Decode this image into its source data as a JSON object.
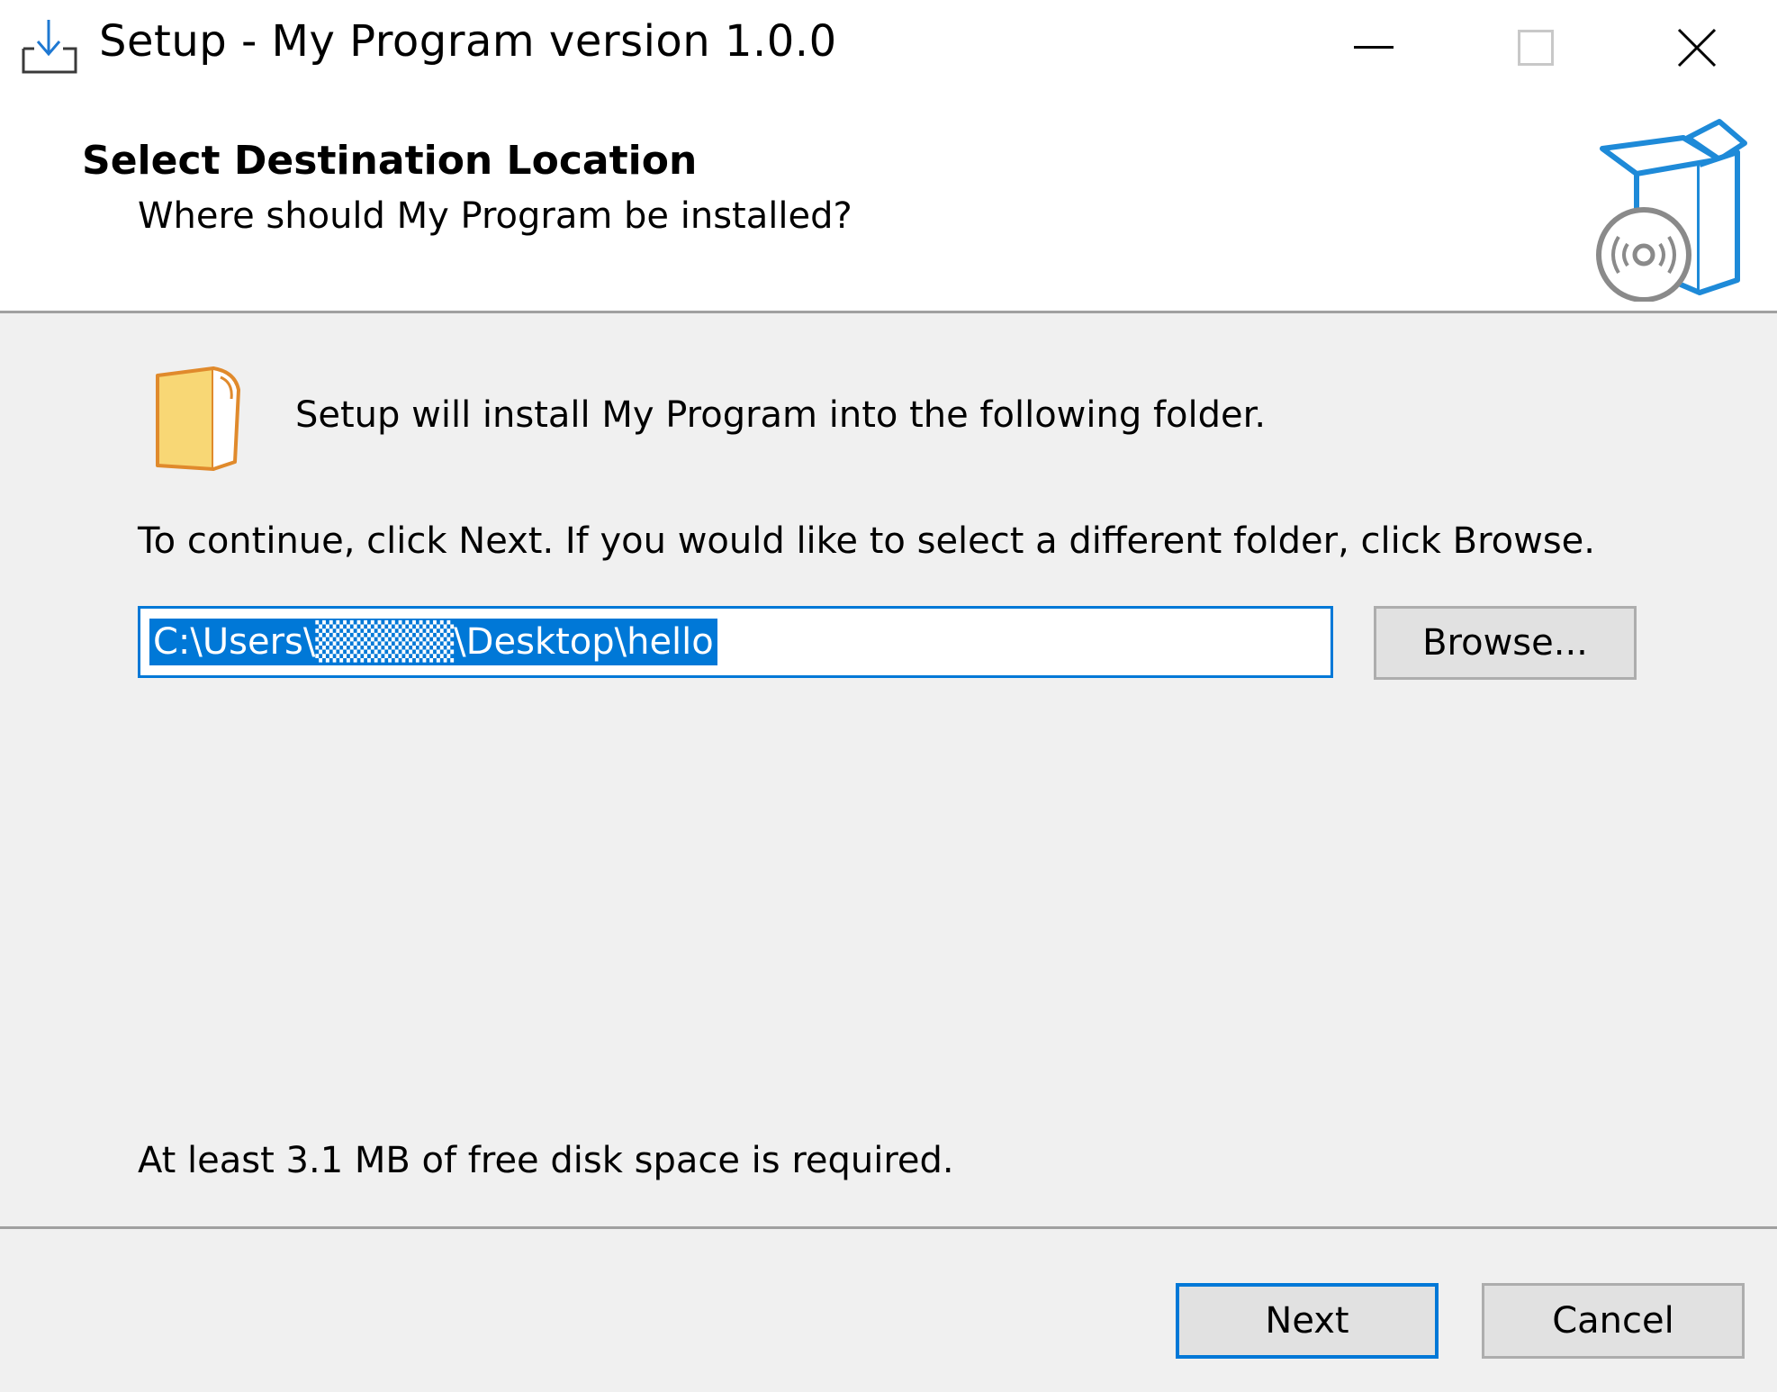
{
  "window": {
    "title": "Setup - My Program version 1.0.0",
    "controls": {
      "minimize_icon": "minimize-icon",
      "maximize_icon": "maximize-icon",
      "close_icon": "close-icon"
    }
  },
  "header": {
    "title": "Select Destination Location",
    "subtitle": "Where should My Program be installed?",
    "graphic_icon": "setup-box-icon"
  },
  "body": {
    "folder_icon": "folder-icon",
    "install_text": "Setup will install My Program into the following folder.",
    "continue_text": "To continue, click Next. If you would like to select a different folder, click Browse.",
    "path_value": "C:\\Users\\▒▒▒▒▒\\Desktop\\hello",
    "browse_label": "Browse...",
    "disk_space_text": "At least 3.1 MB of free disk space is required."
  },
  "footer": {
    "next_label": "Next",
    "cancel_label": "Cancel"
  },
  "colors": {
    "accent": "#0078d7",
    "panel": "#f0f0f0",
    "button_face": "#e1e1e1",
    "folder": "#f8d775",
    "folder_edge": "#e08a2c"
  }
}
